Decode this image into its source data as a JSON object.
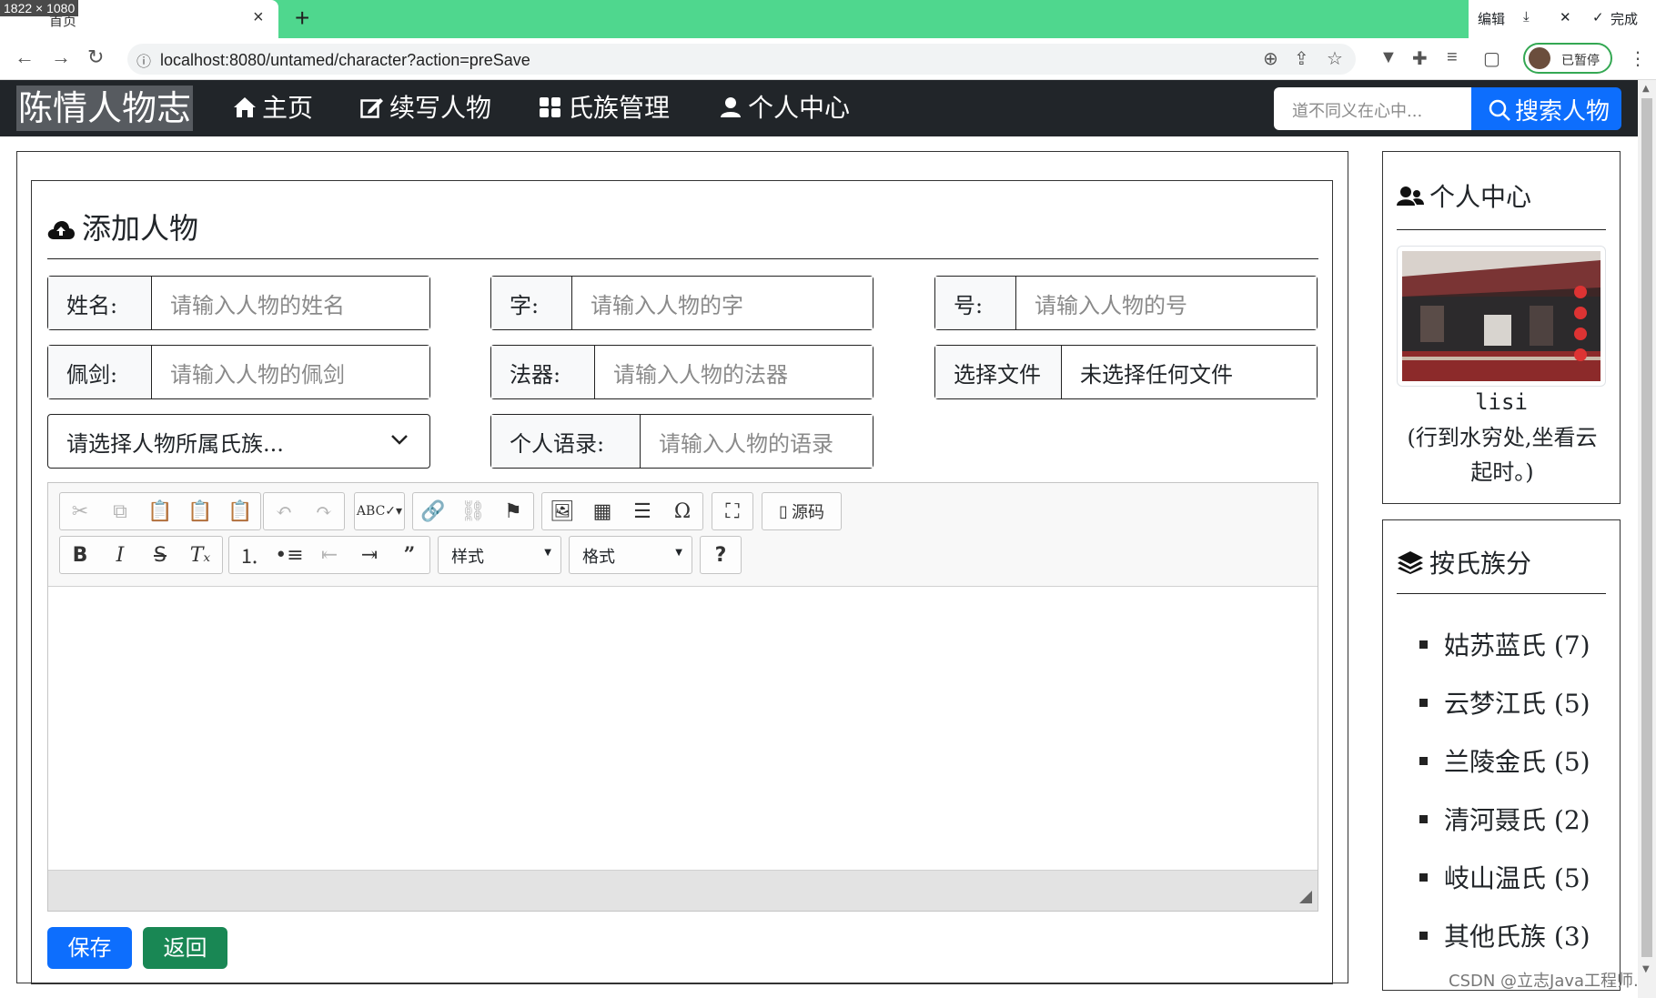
{
  "browser": {
    "dimension_badge": "1822 × 1080",
    "tab_title": "首页",
    "url": "localhost:8080/untamed/character?action=preSave",
    "profile_status": "已暂停",
    "capture_toolbar": {
      "edit": "编辑",
      "done": "完成"
    }
  },
  "navbar": {
    "brand": "陈情人物志",
    "items": [
      {
        "label": "主页",
        "icon": "home-icon"
      },
      {
        "label": "续写人物",
        "icon": "edit-icon"
      },
      {
        "label": "氏族管理",
        "icon": "grid-icon"
      },
      {
        "label": "个人中心",
        "icon": "user-icon"
      }
    ],
    "search_placeholder": "道不同义在心中...",
    "search_button": "搜索人物"
  },
  "form": {
    "title": "添加人物",
    "name_label": "姓名:",
    "name_placeholder": "请输入人物的姓名",
    "zi_label": "字:",
    "zi_placeholder": "请输入人物的字",
    "hao_label": "号:",
    "hao_placeholder": "请输入人物的号",
    "sword_label": "佩剑:",
    "sword_placeholder": "请输入人物的佩剑",
    "artifact_label": "法器:",
    "artifact_placeholder": "请输入人物的法器",
    "file_button": "选择文件",
    "file_status": "未选择任何文件",
    "clan_select": "请选择人物所属氏族...",
    "quote_label": "个人语录:",
    "quote_placeholder": "请输入人物的语录",
    "editor": {
      "source_label": "源码",
      "styles_label": "样式",
      "format_label": "格式",
      "help_label": "?"
    },
    "save_button": "保存",
    "back_button": "返回"
  },
  "sidebar": {
    "profile_title": "个人中心",
    "username": "lisi",
    "motto": "(行到水穷处,坐看云起时。)",
    "clan_title": "按氏族分",
    "clans": [
      {
        "label": "姑苏蓝氏 (7)"
      },
      {
        "label": "云梦江氏 (5)"
      },
      {
        "label": "兰陵金氏 (5)"
      },
      {
        "label": "清河聂氏 (2)"
      },
      {
        "label": "岐山温氏 (5)"
      },
      {
        "label": "其他氏族 (3)"
      }
    ]
  },
  "watermark": "CSDN @立志Java工程师.",
  "colors": {
    "primary": "#0d6efd",
    "success": "#198754",
    "navbar": "#212529",
    "tabbar": "#4fd78e"
  }
}
